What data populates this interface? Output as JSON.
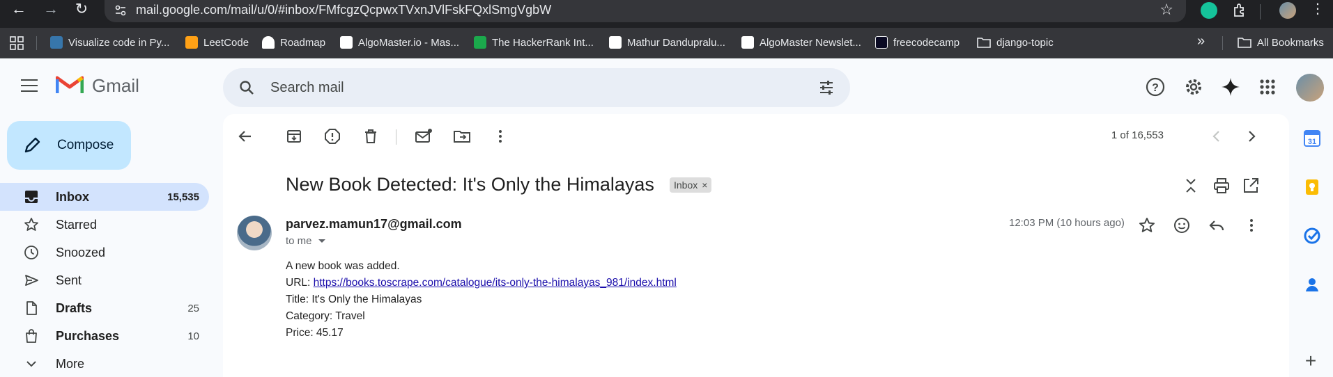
{
  "browser": {
    "url": "mail.google.com/mail/u/0/#inbox/FMfcgzQcpwxTVxnJVlFskFQxlSmgVgbW",
    "bookmarks": [
      {
        "label": "Visualize code in Py...",
        "color": "#3776ab"
      },
      {
        "label": "LeetCode",
        "color": "#ffa116"
      },
      {
        "label": "Roadmap",
        "color": "#ffffff"
      },
      {
        "label": "AlgoMaster.io - Mas...",
        "color": "#ffffff"
      },
      {
        "label": "The HackerRank Int...",
        "color": "#1ba94c"
      },
      {
        "label": "Mathur Dandupralu...",
        "color": "#ffffff"
      },
      {
        "label": "AlgoMaster Newslet...",
        "color": "#ffffff"
      },
      {
        "label": "freecodecamp",
        "color": "#0a0a23"
      },
      {
        "label": "django-topic",
        "color": "#e8eaed"
      }
    ],
    "all_bookmarks": "All Bookmarks",
    "overflow": "»"
  },
  "gmail": {
    "brand": "Gmail",
    "search_placeholder": "Search mail",
    "compose_label": "Compose",
    "nav": [
      {
        "label": "Inbox",
        "count": "15,535",
        "bold": true,
        "active": true,
        "icon": "inbox-icon"
      },
      {
        "label": "Starred",
        "count": "",
        "bold": false,
        "active": false,
        "icon": "star-icon"
      },
      {
        "label": "Snoozed",
        "count": "",
        "bold": false,
        "active": false,
        "icon": "clock-icon"
      },
      {
        "label": "Sent",
        "count": "",
        "bold": false,
        "active": false,
        "icon": "send-icon"
      },
      {
        "label": "Drafts",
        "count": "25",
        "bold": true,
        "active": false,
        "icon": "draft-icon"
      },
      {
        "label": "Purchases",
        "count": "10",
        "bold": true,
        "active": false,
        "icon": "shopping-bag-icon"
      },
      {
        "label": "More",
        "count": "",
        "bold": false,
        "active": false,
        "icon": "chevron-down-icon"
      }
    ]
  },
  "message": {
    "pager": "1 of 16,553",
    "subject": "New Book Detected: It's Only the Himalayas",
    "label": "Inbox",
    "label_close": "×",
    "sender": "parvez.mamun17@gmail.com",
    "to": "to me",
    "timestamp": "12:03 PM (10 hours ago)",
    "body_intro": "A new book was added.",
    "url_label": "URL: ",
    "url": "https://books.toscrape.com/catalogue/its-only-the-himalayas_981/index.html",
    "title_line": "Title: It's Only the Himalayas",
    "category_line": "Category: Travel",
    "price_line": "Price: 45.17"
  },
  "side_panel": {
    "calendar_day": "31"
  },
  "colors": {
    "accent": "#0b57d0",
    "active_nav": "#d3e3fd",
    "compose": "#c2e7ff"
  }
}
